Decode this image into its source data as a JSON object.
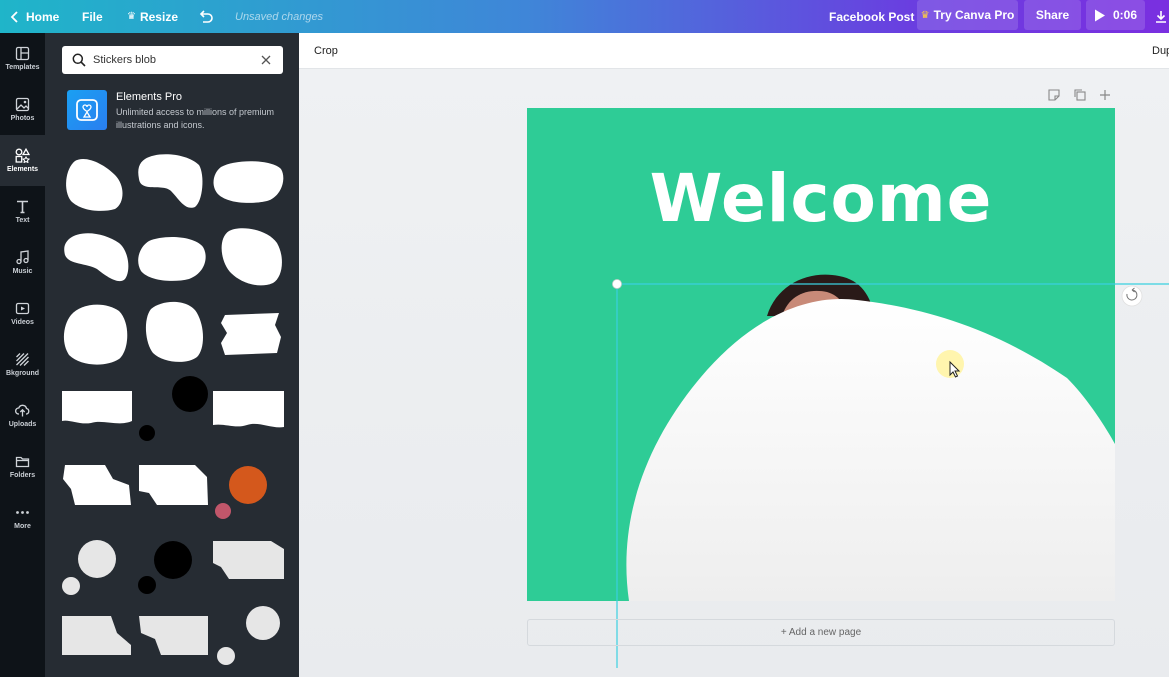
{
  "topbar": {
    "home_label": "Home",
    "file_label": "File",
    "resize_label": "Resize",
    "status_text": "Unsaved changes",
    "doc_type": "Facebook Post",
    "try_pro_label": "Try Canva Pro",
    "share_label": "Share",
    "play_time": "0:06"
  },
  "rail": {
    "items": [
      {
        "label": "Templates",
        "icon": "templates-icon"
      },
      {
        "label": "Photos",
        "icon": "photos-icon"
      },
      {
        "label": "Elements",
        "icon": "elements-icon"
      },
      {
        "label": "Text",
        "icon": "text-icon"
      },
      {
        "label": "Music",
        "icon": "music-icon"
      },
      {
        "label": "Videos",
        "icon": "videos-icon"
      },
      {
        "label": "Bkground",
        "icon": "background-icon"
      },
      {
        "label": "Uploads",
        "icon": "uploads-icon"
      },
      {
        "label": "Folders",
        "icon": "folders-icon"
      },
      {
        "label": "More",
        "icon": "more-icon"
      }
    ],
    "active_index": 2
  },
  "panel": {
    "search_value": "Stickers blob",
    "pro_title": "Elements Pro",
    "pro_description": "Unlimited access to millions of premium illustrations and icons."
  },
  "toolbar": {
    "crop_label": "Crop",
    "duplicate_label": "Dup"
  },
  "canvas": {
    "heading": "Welcome",
    "background_color": "#2ecc96",
    "add_page_label": "+ Add a new page"
  },
  "colors": {
    "accent_teal": "#1fb5c9",
    "accent_purple": "#7a2fe0",
    "panel_bg": "#262c33",
    "selection": "#3ad0e0",
    "orange_circle": "#d4581c",
    "pink_circle": "#c1566a"
  }
}
